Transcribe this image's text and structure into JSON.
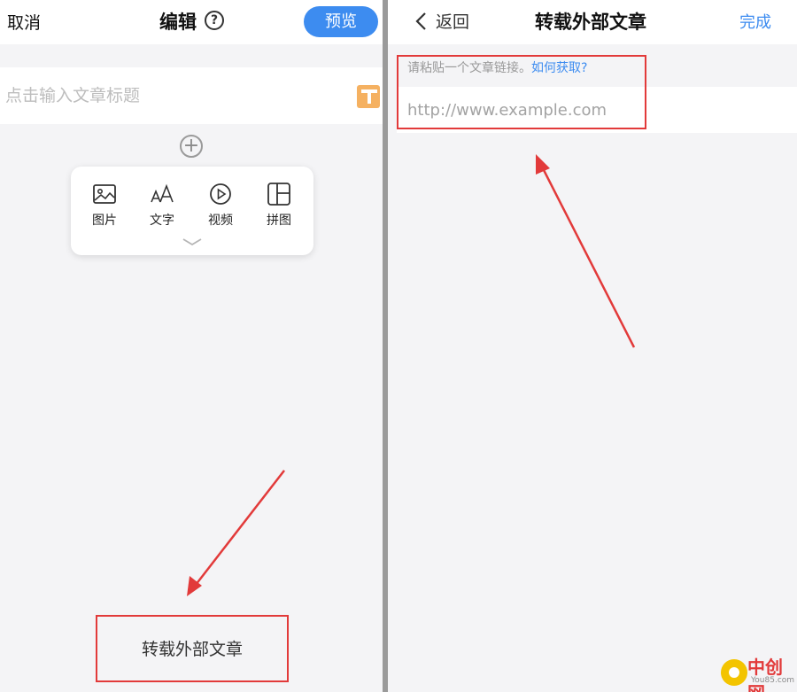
{
  "editor": {
    "header": {
      "cancel_label": "取消",
      "title": "编辑",
      "help_icon": "?",
      "preview_label": "预览"
    },
    "title_placeholder": "点击输入文章标题",
    "template_icon": "T",
    "add_symbol": "+",
    "insert_menu": [
      {
        "label": "图片",
        "icon": "image-icon"
      },
      {
        "label": "文字",
        "icon": "text-icon"
      },
      {
        "label": "视频",
        "icon": "video-icon"
      },
      {
        "label": "拼图",
        "icon": "grid-icon"
      }
    ],
    "external_article_label": "转载外部文章"
  },
  "import_page": {
    "header": {
      "back_label": "返回",
      "title": "转载外部文章",
      "done_label": "完成"
    },
    "hint_text": "请粘贴一个文章链接。",
    "hint_link": "如何获取?",
    "url_placeholder": "http://www.example.com"
  },
  "watermark": {
    "text": "中创网",
    "sub": "You85.com"
  },
  "colors": {
    "accent": "#3d8cf0",
    "annotation_red": "#e23a3a",
    "template_orange": "#f5b161",
    "background": "#f4f4f6"
  }
}
